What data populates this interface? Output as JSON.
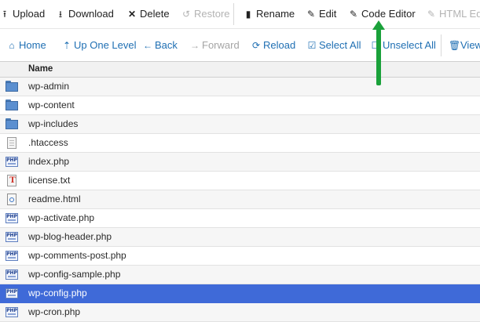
{
  "toolbar_top": {
    "upload": "Upload",
    "download": "Download",
    "delete": "Delete",
    "restore": "Restore",
    "rename": "Rename",
    "edit": "Edit",
    "code_editor": "Code Editor",
    "html_editor": "HTML Edit"
  },
  "toolbar_nav": {
    "home": "Home",
    "up_one_level": "Up One Level",
    "back": "Back",
    "forward": "Forward",
    "reload": "Reload",
    "select_all": "Select All",
    "unselect_all": "Unselect All",
    "view": "View"
  },
  "table": {
    "column_name": "Name",
    "rows": [
      {
        "name": "wp-admin",
        "icon": "folder-icon"
      },
      {
        "name": "wp-content",
        "icon": "folder-icon"
      },
      {
        "name": "wp-includes",
        "icon": "folder-icon"
      },
      {
        "name": ".htaccess",
        "icon": "file-icon"
      },
      {
        "name": "index.php",
        "icon": "php-file-icon"
      },
      {
        "name": "license.txt",
        "icon": "text-file-icon"
      },
      {
        "name": "readme.html",
        "icon": "html-file-icon"
      },
      {
        "name": "wp-activate.php",
        "icon": "php-file-icon"
      },
      {
        "name": "wp-blog-header.php",
        "icon": "php-file-icon"
      },
      {
        "name": "wp-comments-post.php",
        "icon": "php-file-icon"
      },
      {
        "name": "wp-config-sample.php",
        "icon": "php-file-icon"
      },
      {
        "name": "wp-config.php",
        "icon": "php-file-icon",
        "selected": true
      },
      {
        "name": "wp-cron.php",
        "icon": "php-file-icon"
      }
    ]
  },
  "colors": {
    "selection": "#3f6ad8",
    "link_blue": "#1f6fb3",
    "annotation_arrow": "#1aa13a"
  }
}
